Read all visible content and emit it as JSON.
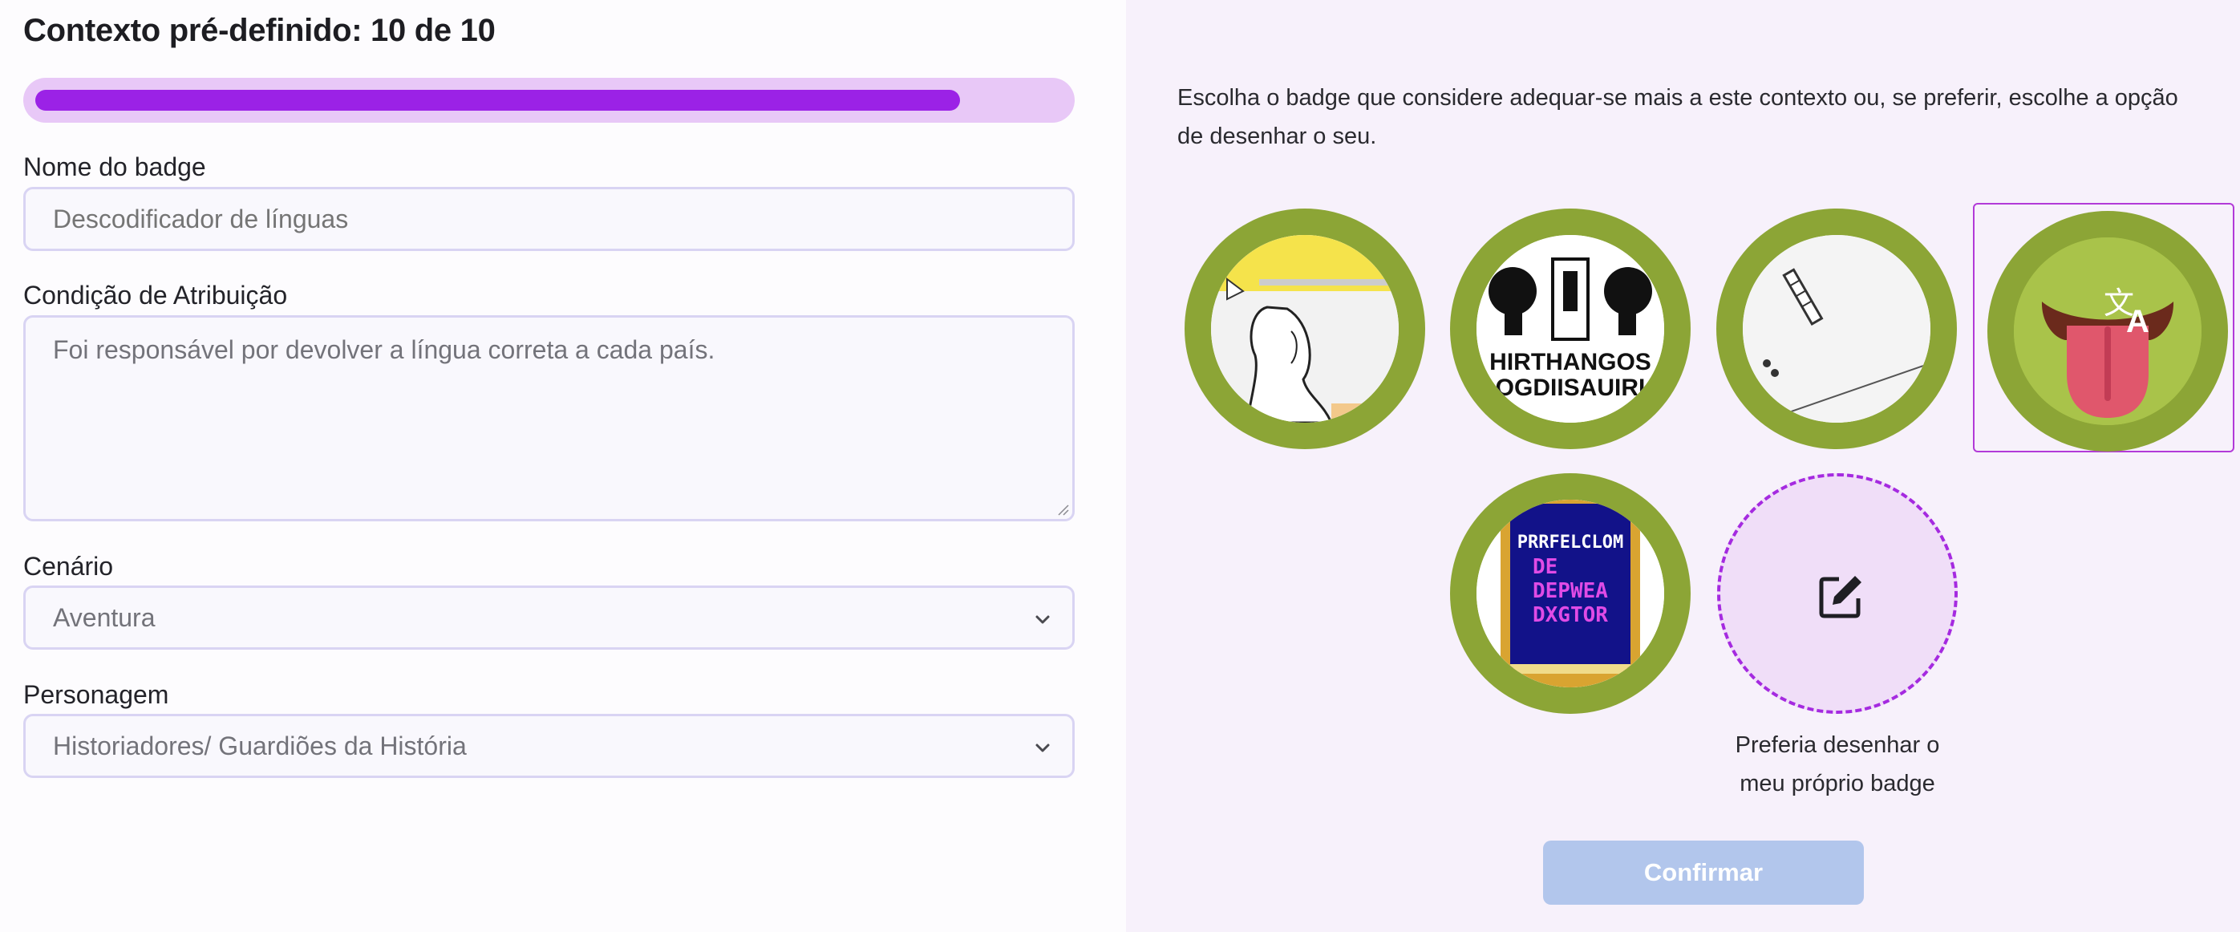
{
  "form": {
    "title": "Contexto pré-definido: 10 de 10",
    "progress": {
      "current": 10,
      "total": 10,
      "fraction": 0.9
    },
    "badge_name": {
      "label": "Nome do badge",
      "placeholder": "Descodificador de línguas"
    },
    "condition": {
      "label": "Condição de Atribuição",
      "placeholder": "Foi responsável por devolver a língua correta a cada país."
    },
    "scenario": {
      "label": "Cenário",
      "value": "Aventura"
    },
    "character": {
      "label": "Personagem",
      "value": "Historiadores/ Guardiões da História"
    }
  },
  "badges": {
    "instruction": "Escolha o badge que considere adequar-se mais a este contexto ou, se preferir, escolhe a opção de desenhar o seu.",
    "options": [
      {
        "id": "badge-1",
        "image": "sketch-person-yellow",
        "selected": false
      },
      {
        "id": "badge-2",
        "image": "twin-figures",
        "text_lines": [
          "HIRTHANGOS",
          "OGDIISAUIRI"
        ],
        "selected": false
      },
      {
        "id": "badge-3",
        "image": "pen-sketch",
        "selected": false
      },
      {
        "id": "badge-4",
        "image": "tongue-translate",
        "selected": true
      },
      {
        "id": "badge-5",
        "image": "pixel-book",
        "text_lines": [
          "PRRFELCLOM",
          "DE",
          "DEPWEA",
          "DXGTOR"
        ],
        "selected": false
      }
    ],
    "draw_own": {
      "caption": "Preferia desenhar o meu próprio badge",
      "icon": "edit-icon"
    }
  },
  "actions": {
    "confirm_label": "Confirmar"
  },
  "colors": {
    "accent": "#9b22e6",
    "progress_track": "#e8c8f7",
    "badge_ring": "#8ca536",
    "confirm_disabled": "#b2c6ec",
    "right_panel_bg": "#f7f1fb"
  }
}
